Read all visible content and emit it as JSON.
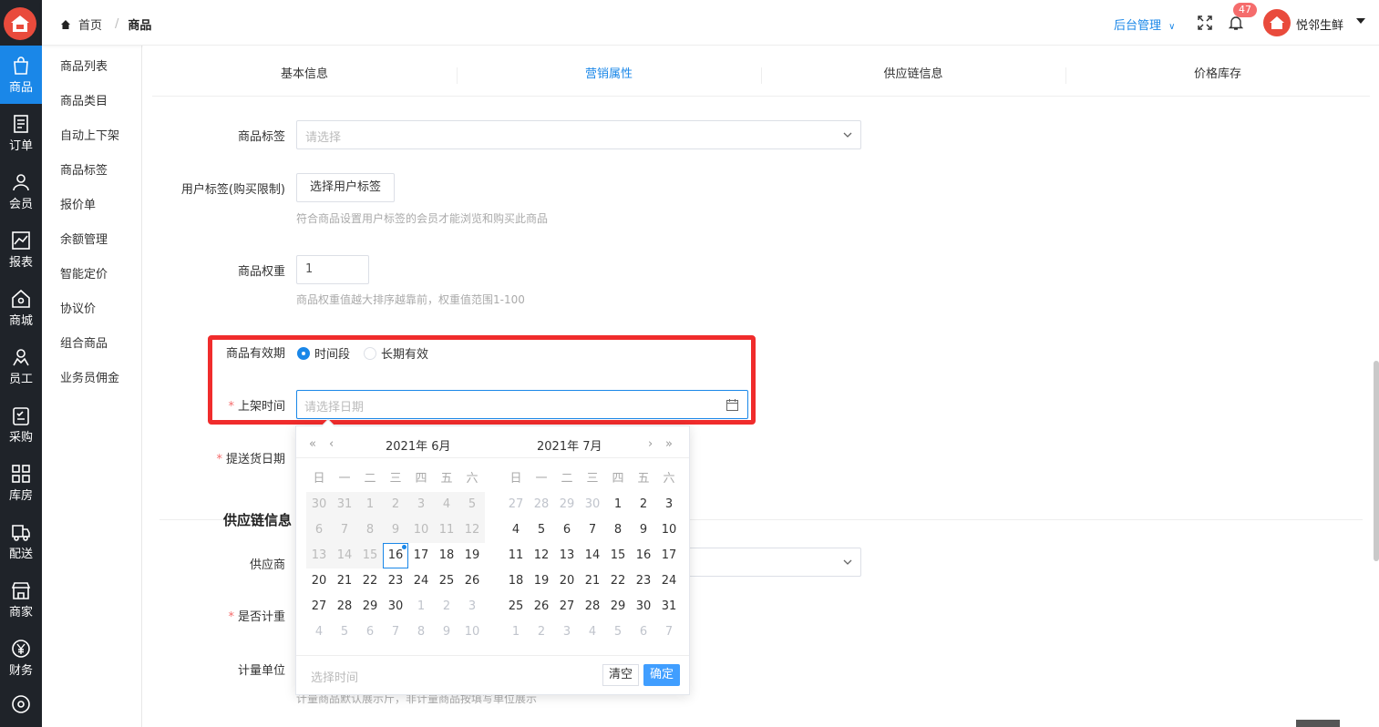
{
  "header": {
    "breadcrumb_home": "首页",
    "breadcrumb_current": "商品",
    "admin_menu": "后台管理",
    "notification_count": "47",
    "username": "悦邻生鲜"
  },
  "rail": {
    "items": [
      {
        "label": "商品",
        "icon": "bag-icon"
      },
      {
        "label": "订单",
        "icon": "document-icon"
      },
      {
        "label": "会员",
        "icon": "user-icon"
      },
      {
        "label": "报表",
        "icon": "chart-icon"
      },
      {
        "label": "商城",
        "icon": "home-icon"
      },
      {
        "label": "员工",
        "icon": "staff-icon"
      },
      {
        "label": "采购",
        "icon": "clipboard-icon"
      },
      {
        "label": "库房",
        "icon": "grid-icon"
      },
      {
        "label": "配送",
        "icon": "truck-icon"
      },
      {
        "label": "商家",
        "icon": "store-icon"
      },
      {
        "label": "财务",
        "icon": "yen-icon"
      }
    ]
  },
  "submenu": {
    "items": [
      "商品列表",
      "商品类目",
      "自动上下架",
      "商品标签",
      "报价单",
      "余额管理",
      "智能定价",
      "协议价",
      "组合商品",
      "业务员佣金"
    ]
  },
  "tabs": [
    "基本信息",
    "营销属性",
    "供应链信息",
    "价格库存"
  ],
  "form": {
    "tag_label": "商品标签",
    "tag_placeholder": "请选择",
    "user_tag_label": "用户标签(购买限制)",
    "user_tag_button": "选择用户标签",
    "user_tag_hint": "符合商品设置用户标签的会员才能浏览和购买此商品",
    "weight_label": "商品权重",
    "weight_value": "1",
    "weight_hint": "商品权重值越大排序越靠前，权重值范围1-100",
    "validity_label": "商品有效期",
    "validity_option_period": "时间段",
    "validity_option_long": "长期有效",
    "shelf_time_label": "上架时间",
    "shelf_time_placeholder": "请选择日期",
    "delivery_date_label": "提送货日期",
    "supply_section_title": "供应链信息",
    "supplier_label": "供应商",
    "weighing_label": "是否计重",
    "unit_label": "计量单位",
    "unit_hint": "计量商品默认展示斤，非计量商品按填写单位展示"
  },
  "datepicker": {
    "left_title": "2021年 6月",
    "right_title": "2021年 7月",
    "weekdays": [
      "日",
      "一",
      "二",
      "三",
      "四",
      "五",
      "六"
    ],
    "left_days": [
      [
        "30",
        "31",
        "1",
        "2",
        "3",
        "4",
        "5"
      ],
      [
        "6",
        "7",
        "8",
        "9",
        "10",
        "11",
        "12"
      ],
      [
        "13",
        "14",
        "15",
        "16",
        "17",
        "18",
        "19"
      ],
      [
        "20",
        "21",
        "22",
        "23",
        "24",
        "25",
        "26"
      ],
      [
        "27",
        "28",
        "29",
        "30",
        "1",
        "2",
        "3"
      ],
      [
        "4",
        "5",
        "6",
        "7",
        "8",
        "9",
        "10"
      ]
    ],
    "right_days": [
      [
        "27",
        "28",
        "29",
        "30",
        "1",
        "2",
        "3"
      ],
      [
        "4",
        "5",
        "6",
        "7",
        "8",
        "9",
        "10"
      ],
      [
        "11",
        "12",
        "13",
        "14",
        "15",
        "16",
        "17"
      ],
      [
        "18",
        "19",
        "20",
        "21",
        "22",
        "23",
        "24"
      ],
      [
        "25",
        "26",
        "27",
        "28",
        "29",
        "30",
        "31"
      ],
      [
        "1",
        "2",
        "3",
        "4",
        "5",
        "6",
        "7"
      ]
    ],
    "today": "16",
    "time_placeholder": "选择时间",
    "clear_label": "清空",
    "confirm_label": "确定"
  },
  "colors": {
    "accent": "#1a87e8",
    "rail_bg": "#1f2329",
    "highlight": "#f02c2c",
    "badge": "#f56c6c"
  }
}
